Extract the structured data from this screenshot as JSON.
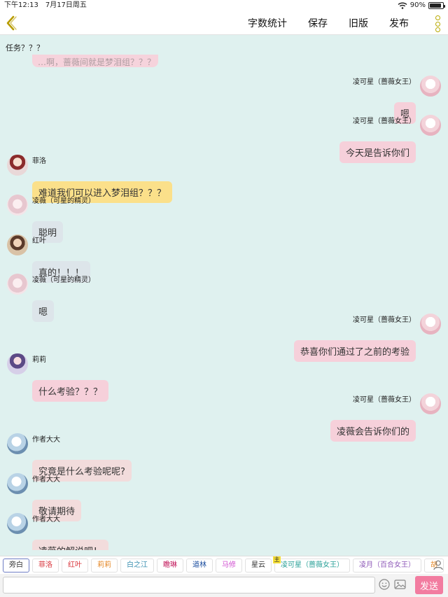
{
  "status": {
    "time": "下午12:13",
    "date": "7月17日周五",
    "battery": "90%",
    "battery_level": 0.9
  },
  "nav": {
    "word_count": "字数统计",
    "save": "保存",
    "old_version": "旧版",
    "publish": "发布"
  },
  "chat": {
    "task_note": "任务？？？",
    "clipped_text": "…啊，蔷薇间就是梦泪组？？？",
    "messages": [
      {
        "side": "right",
        "name": "凌可星（蔷薇女王）",
        "text": "嗯",
        "avatar": "queen-avatar",
        "style": "b-pink"
      },
      {
        "side": "right",
        "name": "凌可星（蔷薇女王）",
        "text": "今天是告诉你们",
        "avatar": "queen-avatar",
        "style": "b-pink"
      },
      {
        "side": "left",
        "name": "菲洛",
        "text": "难道我们可以进入梦泪组？？？",
        "avatar": "feiluo-avatar",
        "style": "b-yellow"
      },
      {
        "side": "left",
        "name": "凌薇（可星的精灵）",
        "text": "聪明",
        "avatar": "lingwei-avatar",
        "style": "b-gray"
      },
      {
        "side": "left",
        "name": "红叶",
        "text": "真的！！！",
        "avatar": "hongye-avatar",
        "style": "b-gray"
      },
      {
        "side": "left",
        "name": "凌薇（可星的精灵）",
        "text": "嗯",
        "avatar": "lingwei-avatar",
        "style": "b-gray"
      },
      {
        "side": "right",
        "name": "凌可星（蔷薇女王）",
        "text": "恭喜你们通过了之前的考验",
        "avatar": "queen-avatar",
        "style": "b-pink"
      },
      {
        "side": "left",
        "name": "莉莉",
        "text": "什么考验？？？",
        "avatar": "lili-avatar",
        "style": "b-rose"
      },
      {
        "side": "right",
        "name": "凌可星（蔷薇女王）",
        "text": "凌薇会告诉你们的",
        "avatar": "queen-avatar",
        "style": "b-pink"
      },
      {
        "side": "left",
        "name": "作者大大",
        "text": "究竟是什么考验呢呢?",
        "avatar": "author-avatar",
        "style": "b-author"
      },
      {
        "side": "left",
        "name": "作者大大",
        "text": "敬请期待",
        "avatar": "author-avatar",
        "style": "b-author"
      },
      {
        "side": "left",
        "name": "作者大大",
        "text": "凌薇的解说吧！",
        "avatar": "author-avatar",
        "style": "b-author"
      }
    ]
  },
  "roles": {
    "items": [
      {
        "label": "旁白",
        "color": "#333333",
        "selected": true
      },
      {
        "label": "菲洛",
        "color": "#d8333a"
      },
      {
        "label": "红叶",
        "color": "#d8333a"
      },
      {
        "label": "莉莉",
        "color": "#e58a2a"
      },
      {
        "label": "白之江",
        "color": "#3a8fb0"
      },
      {
        "label": "瞻琳",
        "color": "#c2185b"
      },
      {
        "label": "道林",
        "color": "#1e4fa0"
      },
      {
        "label": "马修",
        "color": "#d04fd0"
      },
      {
        "label": "星云",
        "color": "#333333"
      },
      {
        "label": "凌可星（蔷薇女王）",
        "color": "#2aa198",
        "owner": "主"
      },
      {
        "label": "凌月（百合女王）",
        "color": "#8e59b8"
      },
      {
        "label": "胡",
        "color": "#e58a2a"
      }
    ]
  },
  "input": {
    "placeholder": "",
    "send": "发送"
  }
}
